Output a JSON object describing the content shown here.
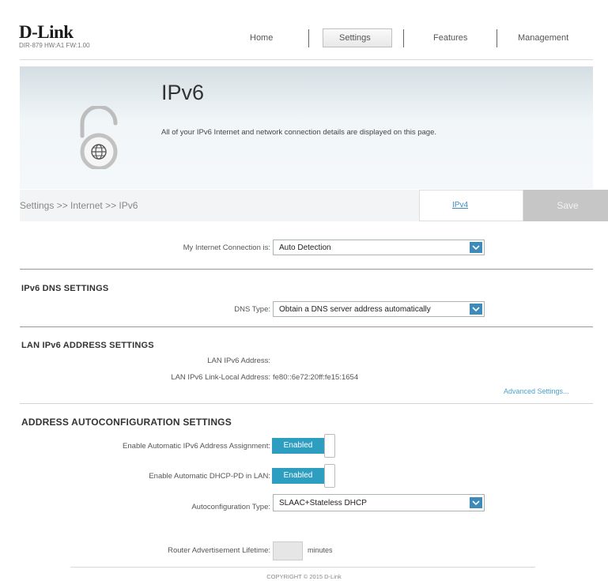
{
  "header": {
    "logo": "D-Link",
    "device_info": "DIR-879 HW:A1 FW:1.00",
    "nav": [
      "Home",
      "Settings",
      "Features",
      "Management"
    ],
    "active_nav": "Settings"
  },
  "banner": {
    "title": "IPv6",
    "description": "All of your IPv6 Internet and network connection details are displayed on this page.",
    "icon": "globe-lock-icon"
  },
  "breadcrumb": "Settings >> Internet >> IPv6",
  "actions": {
    "ipv4_link": "IPv4",
    "save": "Save"
  },
  "connection": {
    "label": "My Internet Connection is:",
    "value": "Auto Detection"
  },
  "dns": {
    "title": "IPv6 DNS SETTINGS",
    "type_label": "DNS Type:",
    "type_value": "Obtain a DNS server address automatically"
  },
  "lan": {
    "title": "LAN IPv6 ADDRESS SETTINGS",
    "address_label": "LAN IPv6 Address:",
    "address_value": "",
    "link_local_label": "LAN IPv6 Link-Local Address:",
    "link_local_value": "fe80::6e72:20ff:fe15:1654",
    "advanced": "Advanced Settings..."
  },
  "autoconfig": {
    "title": "ADDRESS AUTOCONFIGURATION SETTINGS",
    "auto_assign_label": "Enable Automatic IPv6 Address Assignment:",
    "auto_assign_value": "Enabled",
    "dhcp_pd_label": "Enable Automatic DHCP-PD in LAN:",
    "dhcp_pd_value": "Enabled",
    "type_label": "Autoconfiguration Type:",
    "type_value": "SLAAC+Stateless DHCP",
    "lifetime_label": "Router Advertisement Lifetime:",
    "lifetime_value": "",
    "lifetime_unit": "minutes"
  },
  "footer": {
    "copyright": "COPYRIGHT © 2015 D-Link"
  },
  "colors": {
    "accent": "#3e8ab8",
    "toggle": "#2d9dc0",
    "link": "#3b8cc0"
  }
}
